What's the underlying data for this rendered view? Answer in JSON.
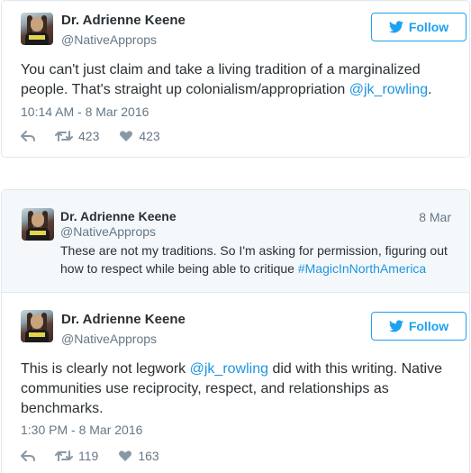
{
  "tweet1": {
    "name": "Dr. Adrienne Keene",
    "handle": "@NativeApprops",
    "follow_label": "Follow",
    "text_before": "You can't just claim and take a living tradition of a marginalized people. That's straight up colonialism/appropriation ",
    "mention": "@jk_rowling",
    "text_after": ".",
    "timestamp": "10:14 AM - 8 Mar 2016",
    "retweets": "423",
    "likes": "423"
  },
  "quoted": {
    "name": "Dr. Adrienne Keene",
    "handle": "@NativeApprops",
    "date": "8 Mar",
    "text_before": "These are not my traditions. So I'm asking for permission, figuring out how to respect while being able to critique ",
    "hashtag": "#MagicInNorthAmerica"
  },
  "tweet2": {
    "name": "Dr. Adrienne Keene",
    "handle": "@NativeApprops",
    "follow_label": "Follow",
    "text_before": "This is clearly not legwork ",
    "mention": "@jk_rowling",
    "text_after": " did with this writing. Native communities use reciprocity, respect, and relationships as benchmarks.",
    "timestamp": "1:30 PM - 8 Mar 2016",
    "retweets": "119",
    "likes": "163"
  },
  "colors": {
    "accent": "#1da1f2",
    "link": "#1b95e0",
    "text": "#292f33",
    "muted": "#657786",
    "border": "#e1e8ed",
    "quoted_bg": "#f5f8fa"
  },
  "icons": {
    "follow": "twitter-bird-icon",
    "reply": "reply-icon",
    "retweet": "retweet-icon",
    "like": "heart-icon"
  }
}
